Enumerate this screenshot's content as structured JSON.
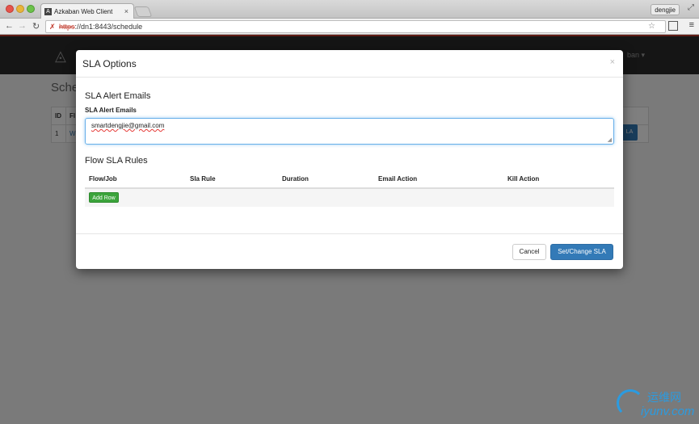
{
  "browser": {
    "tab_title": "Azkaban Web Client",
    "tab_close": "×",
    "user": "dengjie",
    "url_scheme": "https",
    "url_rest": "://dn1:8443/schedule"
  },
  "background_page": {
    "title": "Sche",
    "table_headers": [
      "ID",
      "Fl"
    ],
    "row": [
      "1",
      "W"
    ],
    "row_button": "LA",
    "user_menu": "ban ▾"
  },
  "modal": {
    "title": "SLA Options",
    "close": "×",
    "alert_section": "SLA Alert Emails",
    "alert_label": "SLA Alert Emails",
    "alert_value": "smartdengjie@gmail.com",
    "rules_section": "Flow SLA Rules",
    "columns": [
      "Flow/Job",
      "Sla Rule",
      "Duration",
      "Email Action",
      "Kill Action"
    ],
    "add_row": "Add Row",
    "cancel": "Cancel",
    "submit": "Set/Change SLA"
  },
  "watermark": {
    "cn": "运维网",
    "en": "iyunv.com"
  },
  "colors": {
    "primary": "#337ab7",
    "success": "#3ca43c",
    "nav_bar": "#2a2a2a",
    "accent_red": "#c0392b"
  }
}
